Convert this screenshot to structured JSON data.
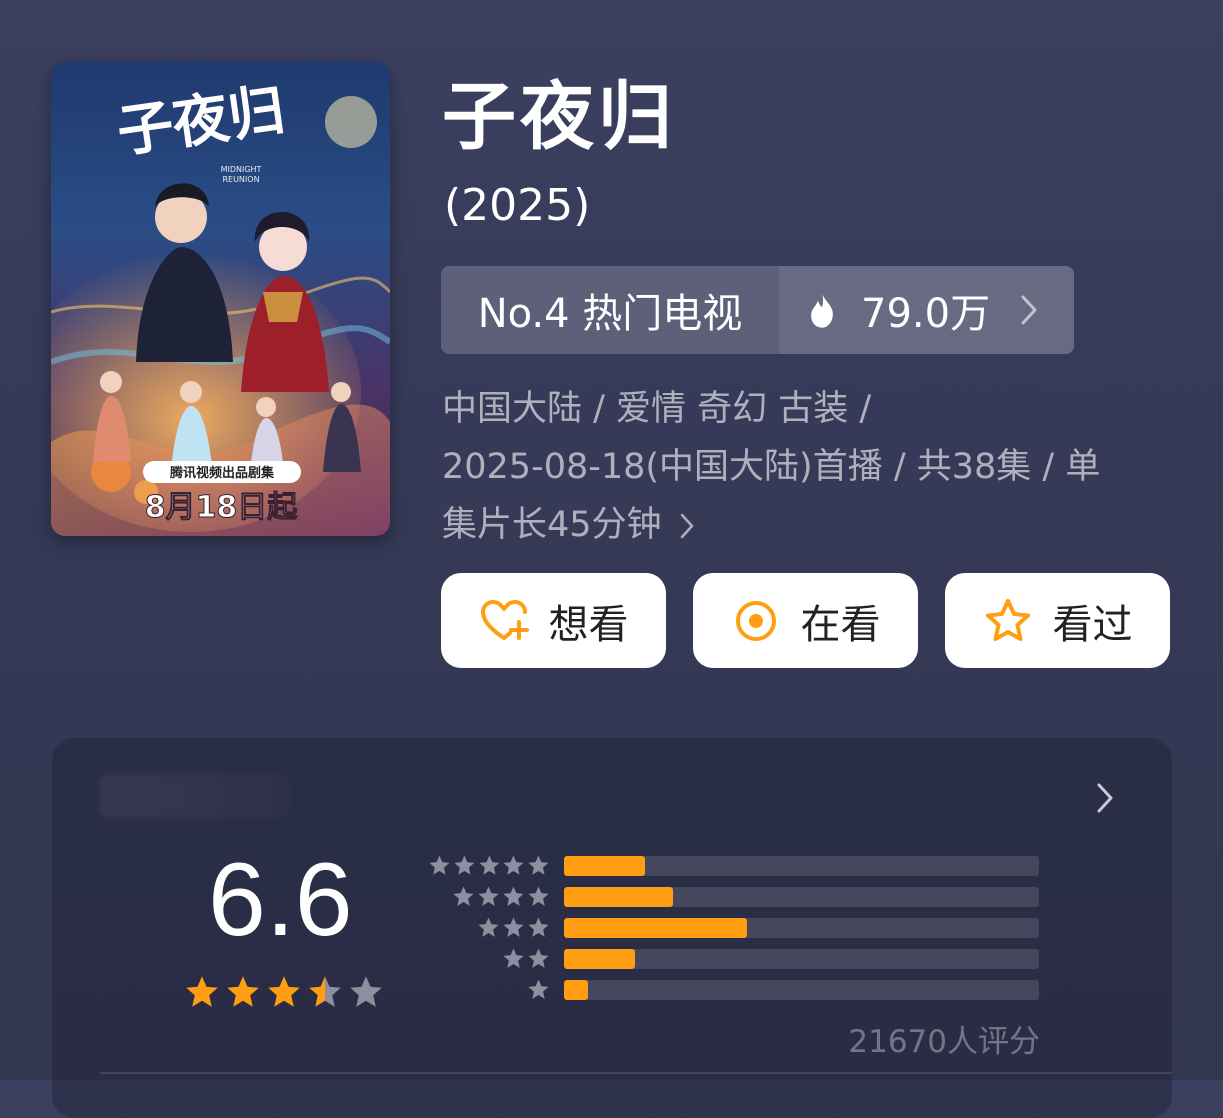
{
  "poster": {
    "banner_text": "腾讯视频出品剧集",
    "date_text": "8月18日起",
    "calligraphy_title": "子夜归",
    "subtitle_en": "MIDNIGHT\nREUNION"
  },
  "title": "子夜归",
  "year": "(2025)",
  "rank": {
    "label": "No.4 热门电视",
    "heat": "79.0万",
    "heat_icon": "fire-icon",
    "chevron_icon": "chevron-right-icon"
  },
  "info": {
    "line1": "中国大陆 / 爱情 奇幻 古装 /",
    "line2": "2025-08-18(中国大陆)首播 / 共38集 / 单",
    "line3": "集片长45分钟"
  },
  "actions": [
    {
      "label": "想看",
      "icon": "heart-plus-icon"
    },
    {
      "label": "在看",
      "icon": "target-circle-icon"
    },
    {
      "label": "看过",
      "icon": "star-outline-icon"
    }
  ],
  "colors": {
    "accent_orange": "#ff9e12",
    "background": "#383d5a",
    "star_gray": "#8c8f9e"
  },
  "rating": {
    "score": "6.6",
    "stars_value": 3.5,
    "stars_max": 5,
    "count": "21670人评分",
    "distribution": [
      {
        "stars": 5,
        "fraction": 0.17
      },
      {
        "stars": 4,
        "fraction": 0.23
      },
      {
        "stars": 3,
        "fraction": 0.385
      },
      {
        "stars": 2,
        "fraction": 0.15
      },
      {
        "stars": 1,
        "fraction": 0.05
      }
    ]
  }
}
